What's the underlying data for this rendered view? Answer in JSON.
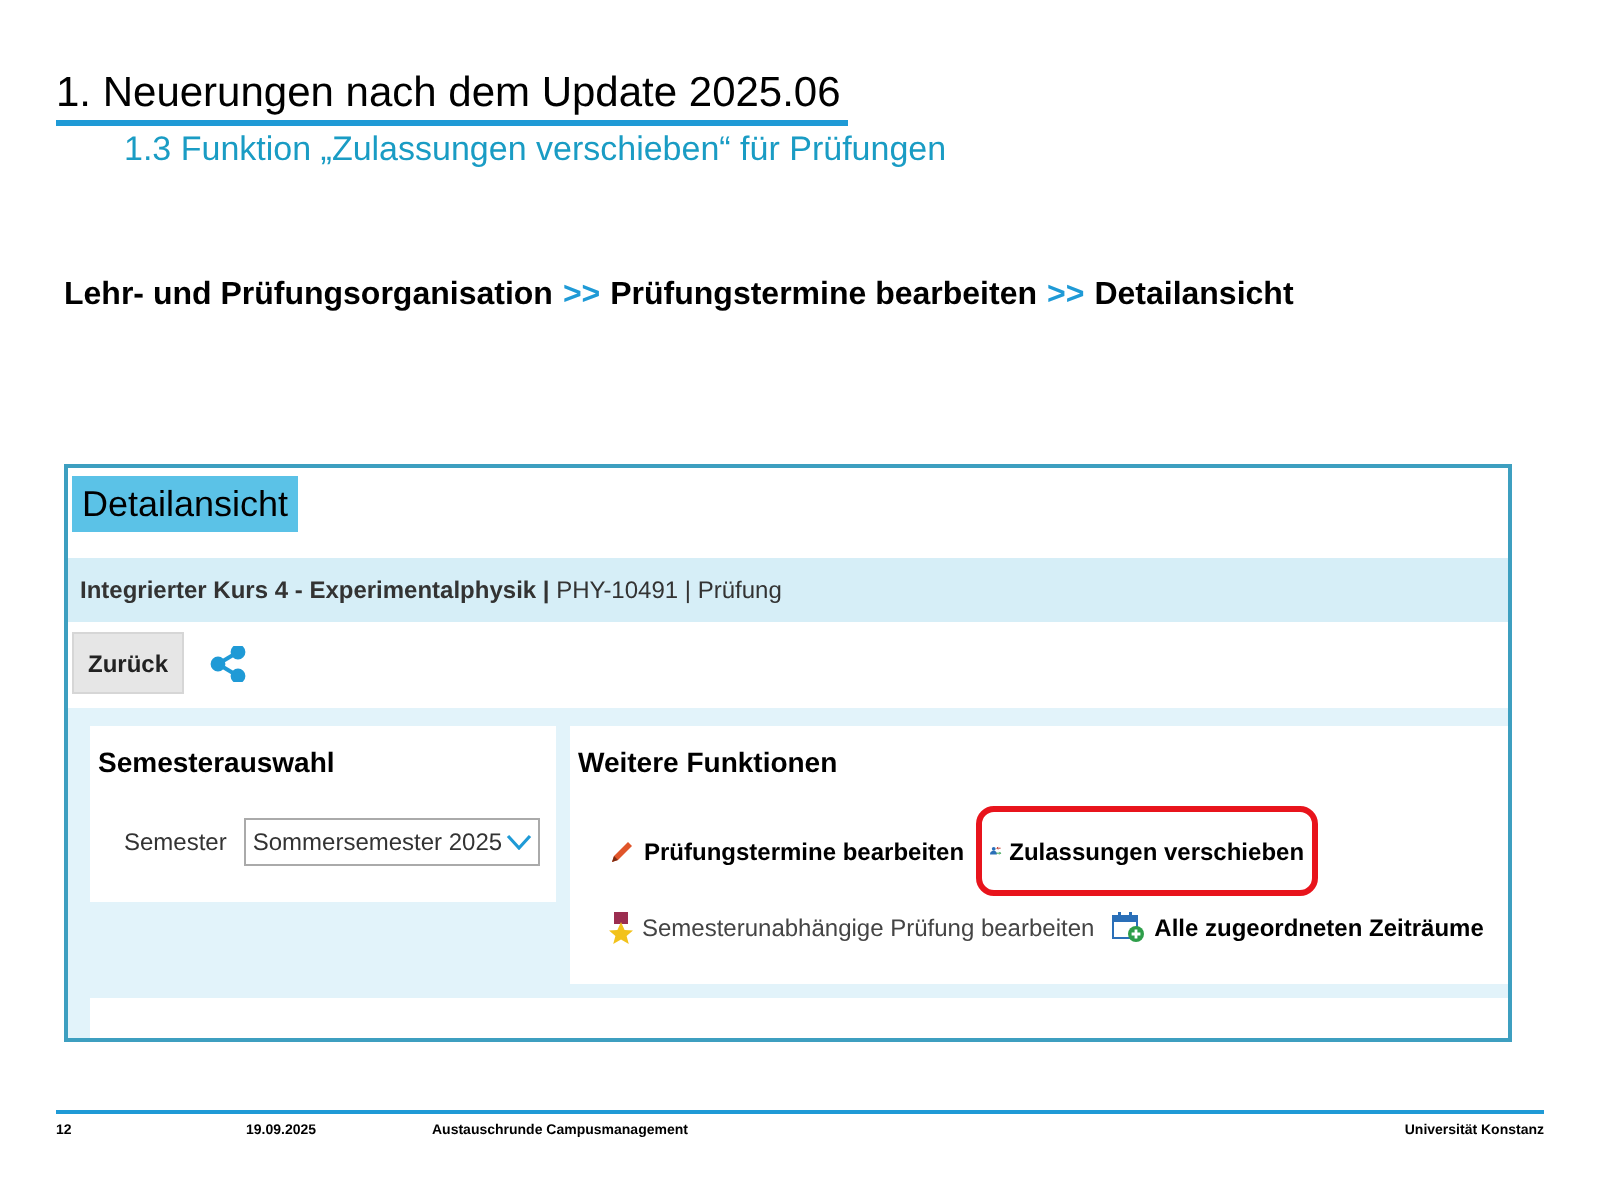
{
  "slide": {
    "title": "1. Neuerungen nach dem Update 2025.06",
    "subtitle": "1.3 Funktion „Zulassungen verschieben“ für Prüfungen"
  },
  "breadcrumb": [
    {
      "kind": "text",
      "label": "Lehr- und Prüfungsorganisation"
    },
    {
      "kind": "separator",
      "label": ">>"
    },
    {
      "kind": "text",
      "label": "Prüfungstermine bearbeiten"
    },
    {
      "kind": "separator",
      "label": ">>"
    },
    {
      "kind": "text",
      "label": "Detailansicht"
    }
  ],
  "screenshot": {
    "heading": "Detailansicht",
    "course": "**Integrierter Kurs 4 - Experimentalphysik |** PHY-10491 | Prüfung",
    "back_button": "Zurück",
    "semester_panel": {
      "title": "Semesterauswahl",
      "label": "Semester",
      "value": "Sommersemester 2025"
    },
    "functions_panel": {
      "title": "Weitere Funktionen",
      "rows": [
        [
          {
            "kind": "pencil",
            "label": "Prüfungstermine bearbeiten",
            "bold": true,
            "highlighted": false
          },
          {
            "kind": "transfer",
            "label": "Zulassungen verschieben",
            "bold": true,
            "highlighted": true
          }
        ],
        [
          {
            "kind": "award",
            "label": "Semesterunabhängige Prüfung bearbeiten",
            "bold": false,
            "highlighted": false
          },
          {
            "kind": "calendar",
            "label": "Alle zugeordneten Zeiträume",
            "bold": true,
            "highlighted": false
          }
        ]
      ]
    }
  },
  "footer": {
    "page": "12",
    "date": "19.09.2025",
    "event": "Austauschrunde Campusmanagement",
    "organization": "Universität Konstanz"
  }
}
